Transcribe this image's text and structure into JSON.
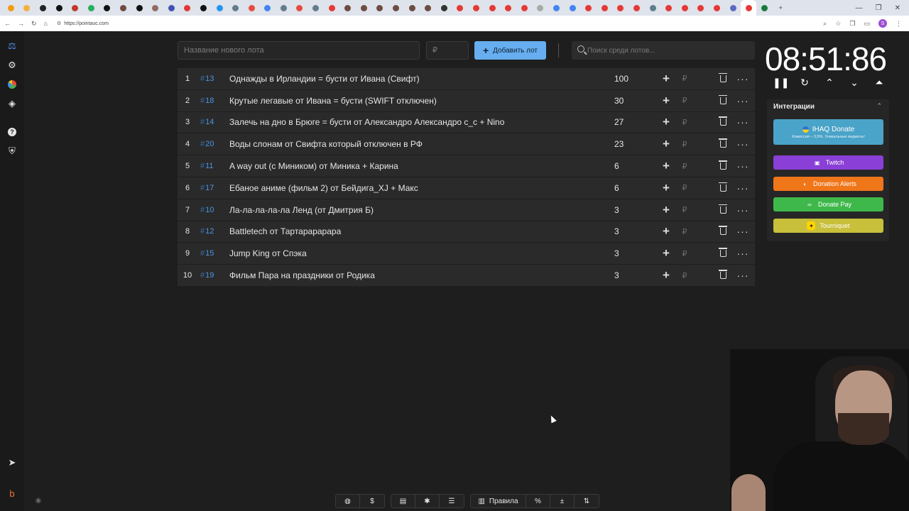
{
  "browser": {
    "url": "https://pointauc.com",
    "tab_icon_colors": [
      "#f39c12",
      "#f5b041",
      "#222",
      "#111",
      "#c0392b",
      "#27ae60",
      "#111",
      "#6d4c41",
      "#111",
      "#8d6e63",
      "#3f51b5",
      "#e53935",
      "#111",
      "#2196f3",
      "#607d8b",
      "#e74c3c",
      "#4285f4",
      "#607d8b",
      "#e74c3c",
      "#607d8b",
      "#e53935",
      "#6d4c41",
      "#6d4c41",
      "#6d4c41",
      "#6d4c41",
      "#6d4c41",
      "#6d4c41",
      "#333",
      "#e53935",
      "#e53935",
      "#e53935",
      "#e53935",
      "#e53935",
      "#aaa",
      "#4285f4",
      "#4285f4",
      "#e53935",
      "#e53935",
      "#e53935",
      "#e53935",
      "#607d8b",
      "#e53935",
      "#e53935",
      "#e53935",
      "#e53935",
      "#5c6bc0",
      "#e53935",
      "#1b7a3a"
    ]
  },
  "rail": {
    "icons": [
      "gavel-icon",
      "gear-icon",
      "wheel-icon",
      "layers-icon",
      "help-icon",
      "shield-icon",
      "telegram-icon",
      "boosty-icon",
      "eye-icon"
    ]
  },
  "toolbar": {
    "lot_name_placeholder": "Название нового лота",
    "price_placeholder": "₽",
    "add_label": "Добавить лот",
    "search_placeholder": "Поиск среди лотов..."
  },
  "lots": [
    {
      "index": "1",
      "id": "13",
      "name": "Однажды в Ирландии = бусти от Ивана (Свифт)",
      "amount": "100"
    },
    {
      "index": "2",
      "id": "18",
      "name": "Крутые легавые от Ивана = бусти (SWIFT отключен)",
      "amount": "30"
    },
    {
      "index": "3",
      "id": "14",
      "name": "Залечь на дно в Брюге  = бусти от Александро Александро с_с + Nino",
      "amount": "27"
    },
    {
      "index": "4",
      "id": "20",
      "name": "Воды слонам от Свифта который отключен в РФ",
      "amount": "23"
    },
    {
      "index": "5",
      "id": "11",
      "name": "A way out (с Миником) от Миника + Карина",
      "amount": "6"
    },
    {
      "index": "6",
      "id": "17",
      "name": "Ебаное аниме (фильм 2) от Бейдига_XJ + Макс",
      "amount": "6"
    },
    {
      "index": "7",
      "id": "10",
      "name": "Ла-ла-ла-ла-ла Ленд (от Дмитрия Б)",
      "amount": "3"
    },
    {
      "index": "8",
      "id": "12",
      "name": "Battletech от Тартарарарара",
      "amount": "3"
    },
    {
      "index": "9",
      "id": "15",
      "name": "Jump King от Спэка",
      "amount": "3"
    },
    {
      "index": "10",
      "id": "19",
      "name": "Фильм Пара на праздники от Родика",
      "amount": "3"
    }
  ],
  "lot_hash": "#",
  "lot_currency": "₽",
  "timer": {
    "value": "08:51:86"
  },
  "integrations": {
    "title": "Интеграции",
    "ihaq_label": "IHAQ Donate",
    "ihaq_sub": "Комиссия – 3,5%. Уникальные виджеты!",
    "twitch": "Twitch",
    "donation_alerts": "Donation Alerts",
    "donate_pay": "Donate Pay",
    "tourniquet": "Tourniquet"
  },
  "bottom": {
    "rules_label": "Правила",
    "dollar": "$",
    "percent": "%"
  },
  "colors": {
    "accent_blue": "#66aef0",
    "twitch": "#8a3fd6",
    "donation_alerts": "#f0761a",
    "donate_pay": "#3fb84b",
    "tourniquet": "#c8bf3a",
    "ihaq": "#4aa3c8"
  }
}
